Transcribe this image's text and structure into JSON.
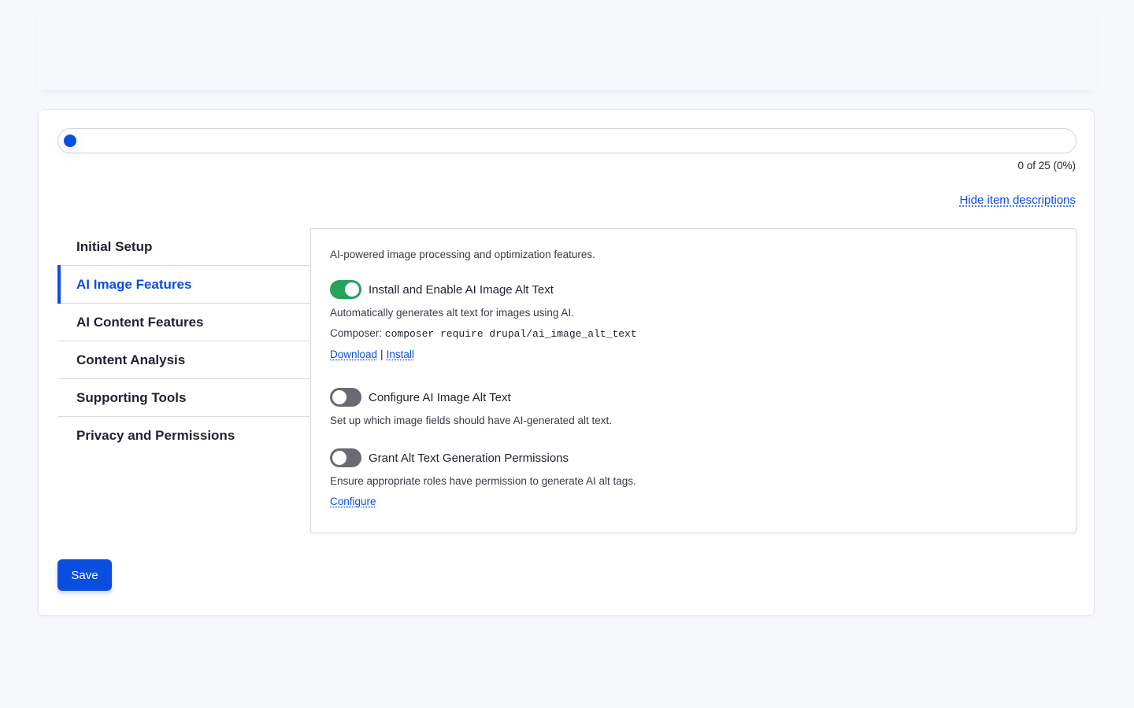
{
  "progress": {
    "completed": 0,
    "total": 25,
    "fraction": 0,
    "count_text": "0 of 25 (0%)",
    "fill_color": "#0a4ee0"
  },
  "hide_descriptions_link": "Hide item descriptions",
  "tabs": [
    {
      "label": "Initial Setup",
      "active": false
    },
    {
      "label": "AI Image Features",
      "active": true
    },
    {
      "label": "AI Content Features",
      "active": false
    },
    {
      "label": "Content Analysis",
      "active": false
    },
    {
      "label": "Supporting Tools",
      "active": false
    },
    {
      "label": "Privacy and Permissions",
      "active": false
    }
  ],
  "panel": {
    "description": "AI-powered image processing and optimization features.",
    "items": [
      {
        "title": "Install and Enable AI Image Alt Text",
        "enabled": true,
        "description": "Automatically generates alt text for images using AI.",
        "composer_label": "Composer:",
        "composer_command": "composer require drupal/ai_image_alt_text",
        "download_link": "Download",
        "separator": "|",
        "install_link": "Install"
      },
      {
        "title": "Configure AI Image Alt Text",
        "enabled": false,
        "description": "Set up which image fields should have AI-generated alt text."
      },
      {
        "title": "Grant Alt Text Generation Permissions",
        "enabled": false,
        "description": "Ensure appropriate roles have permission to generate AI alt tags.",
        "configure_link": "Configure"
      }
    ]
  },
  "save_button": "Save",
  "colors": {
    "accent": "#0a4ee0",
    "toggle_on": "#23a35c",
    "toggle_off": "#6a6b72"
  }
}
